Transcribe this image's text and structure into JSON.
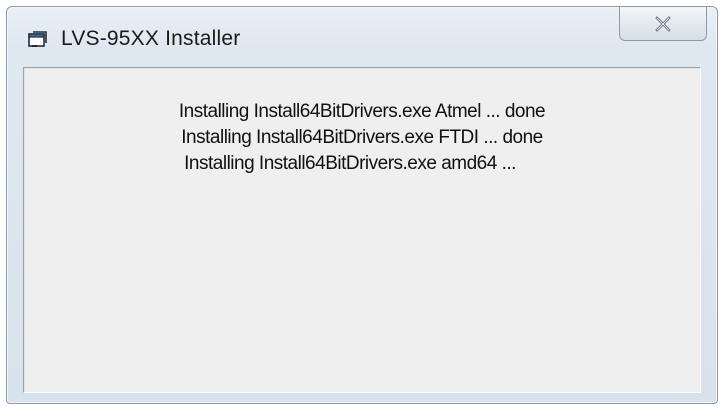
{
  "window": {
    "title": "LVS-95XX Installer",
    "icon": "app-window-icon",
    "close_icon": "close-icon"
  },
  "log": {
    "lines": [
      "Installing Install64BitDrivers.exe Atmel ... done",
      "Installing Install64BitDrivers.exe FTDI ... done",
      "Installing Install64BitDrivers.exe amd64 ...     "
    ]
  },
  "colors": {
    "client_background": "#efefef",
    "frame_background": "#dfe8f0",
    "text": "#111111"
  }
}
